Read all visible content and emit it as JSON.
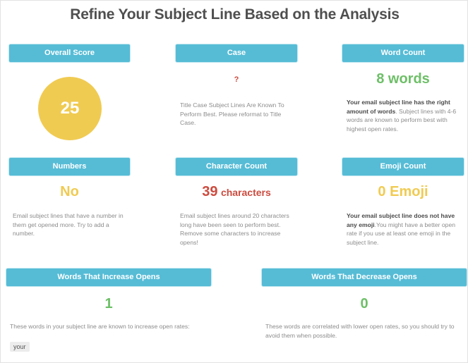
{
  "title": "Refine Your Subject Line Based on the Analysis",
  "colors": {
    "header_bg": "#56bcd6",
    "good": "#6dbf67",
    "warn": "#f0cb52",
    "bad": "#cc4b3f"
  },
  "cards": {
    "overall_score": {
      "header": "Overall Score",
      "value": "25",
      "status": "warn"
    },
    "case": {
      "header": "Case",
      "value": "?",
      "status": "bad",
      "description": "Title Case Subject Lines Are Known To Perform Best. Please reformat to Title Case."
    },
    "word_count": {
      "header": "Word Count",
      "value": "8 words",
      "status": "good",
      "description_bold": "Your email subject line has the right amount of words",
      "description_rest": ". Subject lines with 4-6 words are known to perform best with highest open rates."
    },
    "numbers": {
      "header": "Numbers",
      "value": "No",
      "status": "warn",
      "description": "Email subject lines that have a number in them get opened more. Try to add a number."
    },
    "character_count": {
      "header": "Character Count",
      "value_number": "39",
      "value_unit": "characters",
      "status": "bad",
      "description": "Email subject lines around 20 characters long have been seen to perform best. Remove some characters to increase opens!"
    },
    "emoji_count": {
      "header": "Emoji Count",
      "value": "0 Emoji",
      "status": "warn",
      "description_bold": "Your email subject line does not have any emoji",
      "description_rest": ".You might have a better open rate if you use at least one emoji in the subject line."
    },
    "increase_words": {
      "header": "Words That Increase Opens",
      "value": "1",
      "status": "good",
      "description": "These words in your subject line are known to increase open rates:",
      "words": [
        "your"
      ]
    },
    "decrease_words": {
      "header": "Words That Decrease Opens",
      "value": "0",
      "status": "good",
      "description": "These words are correlated with lower open rates, so you should try to avoid them when possible."
    }
  }
}
